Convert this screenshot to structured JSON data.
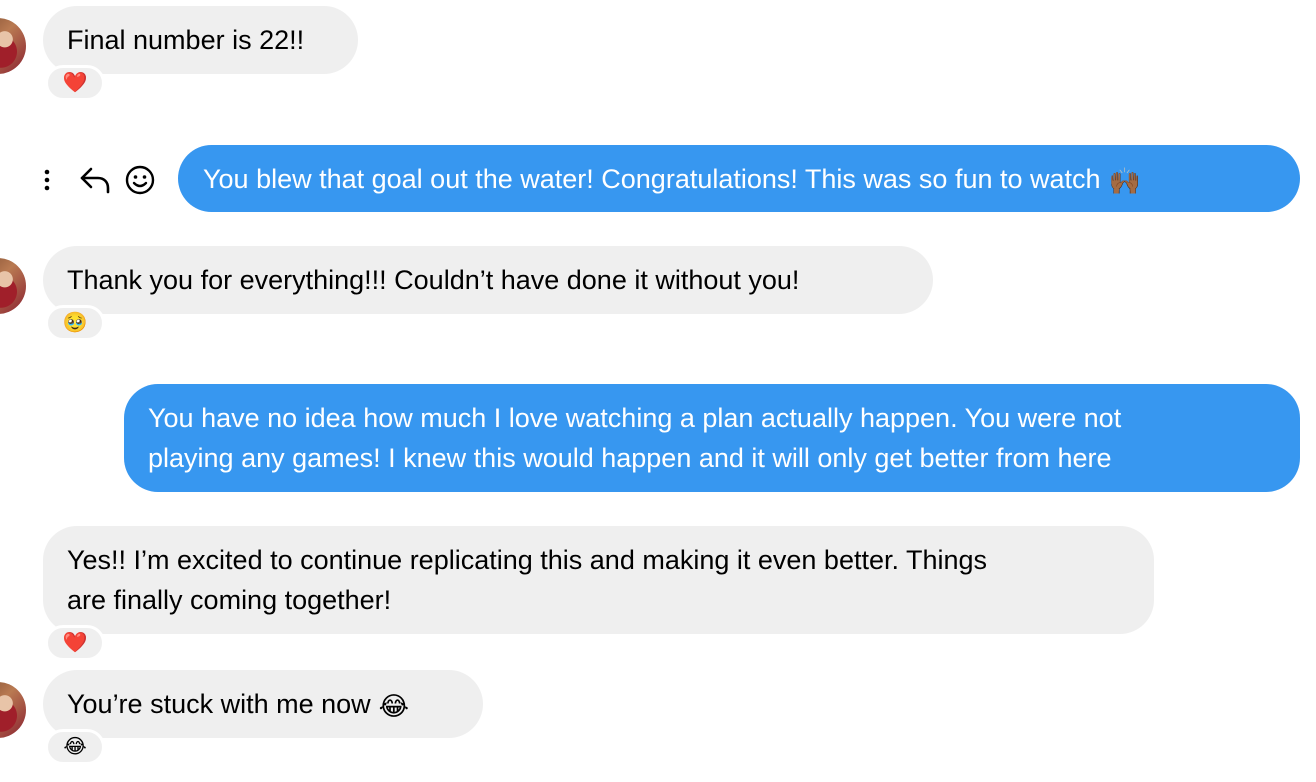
{
  "messages": [
    {
      "direction": "incoming",
      "text": "Final number is 22!!",
      "reaction": "❤️"
    },
    {
      "direction": "outgoing",
      "text": "You blew that goal out the water! Congratulations! This was so fun to watch",
      "emoji": "🙌🏾"
    },
    {
      "direction": "incoming",
      "text": "Thank you for everything!!! Couldn’t have done it without you!",
      "reaction": "🥹"
    },
    {
      "direction": "outgoing",
      "lines": [
        "You have no idea how much I love watching a plan actually happen. You were not",
        "playing any games! I knew this would happen and it will only get better from here"
      ]
    },
    {
      "direction": "incoming",
      "lines": [
        "Yes!! I’m excited to continue replicating this and making it even better. Things",
        "are finally coming together!"
      ],
      "reaction": "❤️"
    },
    {
      "direction": "incoming",
      "text": "You’re stuck with me now",
      "emoji": "😂",
      "reaction": "😂"
    }
  ],
  "message_actions": {
    "more_icon": "more-vertical-icon",
    "reply_icon": "reply-arrow-icon",
    "react_icon": "smiley-icon"
  },
  "colors": {
    "incoming_bubble": "#efefef",
    "outgoing_bubble": "#3797f0",
    "outgoing_text": "#ffffff"
  }
}
